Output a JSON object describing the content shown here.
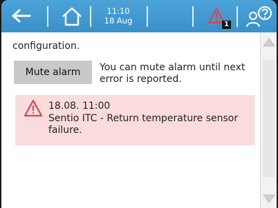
{
  "statusbar": {
    "time": "11:10",
    "date": "18 Aug",
    "alarm_count": "1"
  },
  "content": {
    "configuration_text": "configuration.",
    "mute_button_label": "Mute alarm",
    "mute_description": "You can mute alarm until next error is reported."
  },
  "alarm": {
    "timestamp": "18.08. 11:00",
    "message": "Sentio ITC - Return temperature sensor failure."
  },
  "colors": {
    "topbar": "#3f97ce",
    "alarm_background": "#fadcdc",
    "alarm_icon": "#d9454e",
    "button": "#c9c9c9"
  },
  "icons": [
    "back-arrow-icon",
    "home-icon",
    "alarm-warning-icon",
    "user-help-icon",
    "alarm-warning-icon",
    "scroll-up-icon",
    "scroll-down-icon"
  ]
}
